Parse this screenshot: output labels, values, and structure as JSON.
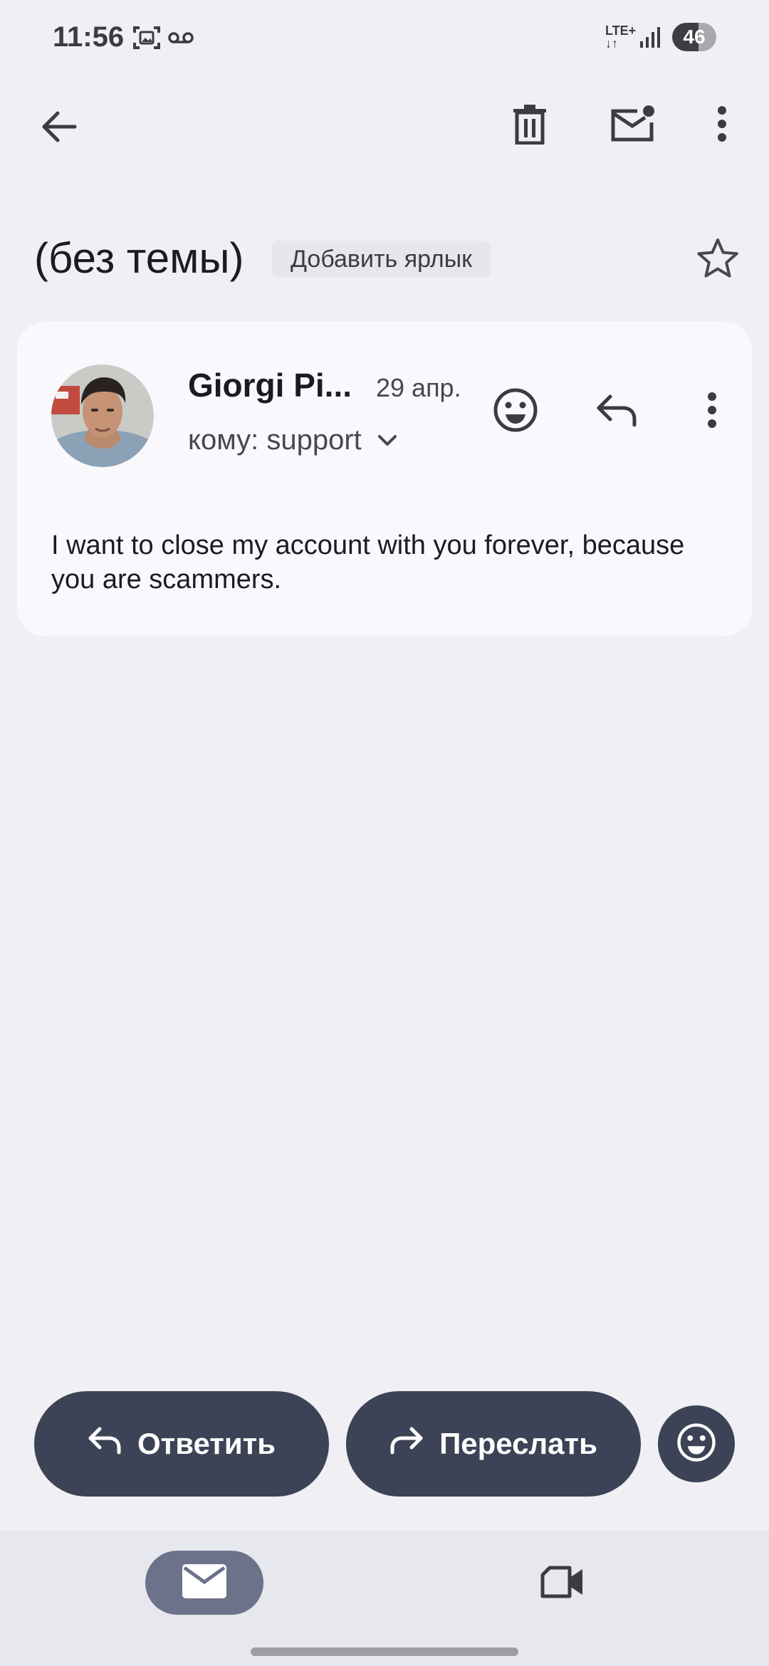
{
  "status_bar": {
    "time": "11:56",
    "network": "LTE+",
    "battery": "46"
  },
  "toolbar": {
    "back_icon": "arrow-left-icon",
    "delete_icon": "trash-icon",
    "mark_unread_icon": "mail-unread-icon",
    "more_icon": "more-vert-icon"
  },
  "thread": {
    "subject": "(без темы)",
    "add_label": "Добавить ярлык",
    "star_icon": "star-outline-icon"
  },
  "message": {
    "sender": "Giorgi Pi...",
    "date": "29 апр.",
    "recipient": "кому: support",
    "body": "I want to close my account with you forever, because you are scammers."
  },
  "actions": {
    "reply_label": "Ответить",
    "forward_label": "Переслать"
  },
  "colors": {
    "background": "#efeff4",
    "card": "#f8f8fd",
    "button": "#3d4356",
    "nav_active": "#6c7289"
  }
}
